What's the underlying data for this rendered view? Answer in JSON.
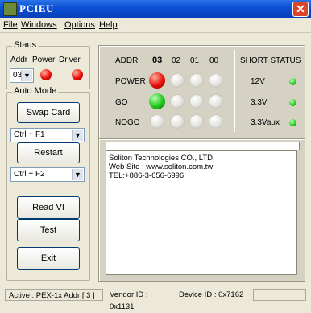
{
  "window": {
    "title": "PCIEU",
    "close_label": "✕"
  },
  "menu": [
    {
      "label": "File"
    },
    {
      "label": "Windows"
    },
    {
      "label": "Options"
    },
    {
      "label": "Help"
    }
  ],
  "status_group": {
    "title": "Staus",
    "addr_label": "Addr",
    "power_label": "Power",
    "driver_label": "Driver",
    "addr_value": "03",
    "power_state": "red",
    "driver_state": "red"
  },
  "auto_mode": {
    "title": "Auto Mode",
    "swap_card_label": "Swap Card",
    "swap_hotkey": "Ctrl + F1",
    "restart_label": "Restart",
    "restart_hotkey": "Ctrl + F2",
    "read_vi_label": "Read VI",
    "test_label": "Test",
    "exit_label": "Exit"
  },
  "status_grid": {
    "addr_header": "ADDR",
    "addresses": [
      "03",
      "02",
      "01",
      "00"
    ],
    "rows": [
      {
        "label": "POWER",
        "states": [
          "red",
          "off",
          "off",
          "off"
        ]
      },
      {
        "label": "GO",
        "states": [
          "green",
          "off",
          "off",
          "off"
        ]
      },
      {
        "label": "NOGO",
        "states": [
          "off",
          "off",
          "off",
          "off"
        ]
      }
    ]
  },
  "short_status": {
    "title": "SHORT STATUS",
    "rails": [
      {
        "label": "12V",
        "color": "#2ed02a"
      },
      {
        "label": "3.3V",
        "color": "#2ed02a"
      },
      {
        "label": "3.3Vaux",
        "color": "#2ed02a"
      }
    ]
  },
  "info_text": {
    "line1": "Soliton Technologies CO., LTD.",
    "line2": "Web Site : www.soliton.com.tw",
    "line3": "TEL:+886-3-656-6996"
  },
  "statusbar": {
    "active": "Active :  PEX-1x Addr [ 3 ]",
    "vendor": "Vendor ID : 0x1131",
    "device": "Device ID : 0x7162"
  }
}
